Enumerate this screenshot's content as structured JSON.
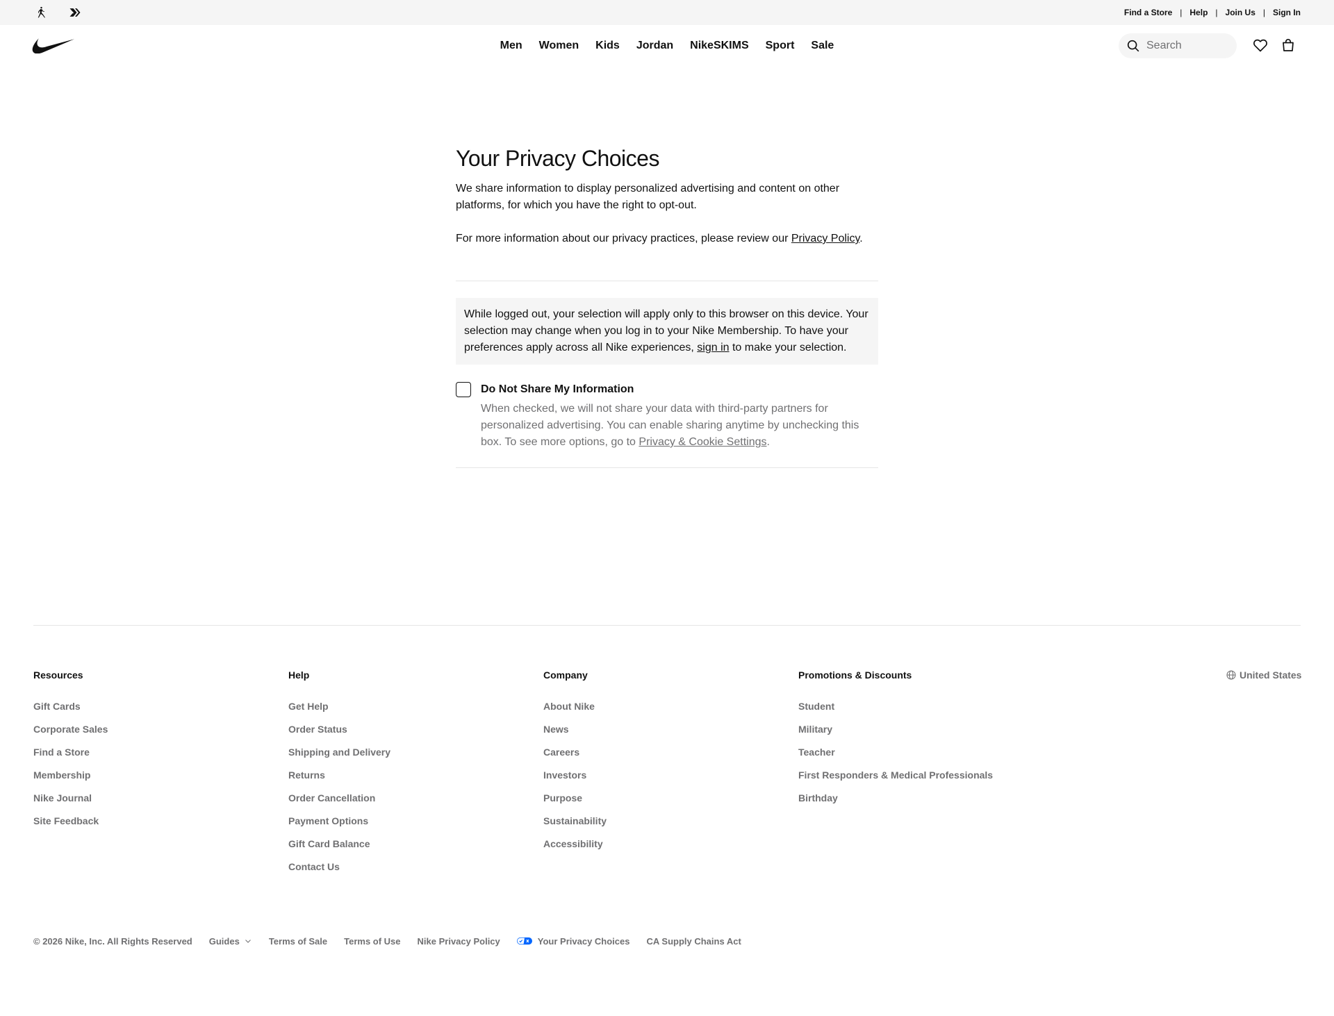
{
  "utility_bar": {
    "brand_icons": [
      "jordan-jumpman-icon",
      "converse-icon"
    ],
    "links": [
      "Find a Store",
      "Help",
      "Join Us",
      "Sign In"
    ],
    "separator": "|"
  },
  "header": {
    "logo": "nike-swoosh-icon",
    "nav": [
      "Men",
      "Women",
      "Kids",
      "Jordan",
      "NikeSKIMS",
      "Sport",
      "Sale"
    ],
    "search_placeholder": "Search",
    "icons": [
      "search-icon",
      "heart-icon",
      "bag-icon"
    ]
  },
  "main": {
    "title": "Your Privacy Choices",
    "para1": "We share information to display personalized advertising and content on other platforms, for which you have the right to opt-out.",
    "para2_prefix": "For more information about our privacy practices, please review our ",
    "para2_link": "Privacy Policy",
    "para2_suffix": ".",
    "info_prefix": "While logged out, your selection will apply only to this browser on this device. Your selection may change when you log in to your Nike Membership. To have your preferences apply across all Nike experiences, ",
    "info_link": "sign in",
    "info_suffix": " to make your selection.",
    "optout_label": "Do Not Share My Information",
    "optout_checked": false,
    "optout_desc_prefix": "When checked, we will not share your data with third-party partners for personalized advertising. You can enable sharing anytime by unchecking this box. To see more options, go to ",
    "optout_desc_link": "Privacy & Cookie Settings",
    "optout_desc_suffix": "."
  },
  "footer": {
    "columns": [
      {
        "heading": "Resources",
        "links": [
          "Gift Cards",
          "Corporate Sales",
          "Find a Store",
          "Membership",
          "Nike Journal",
          "Site Feedback"
        ]
      },
      {
        "heading": "Help",
        "links": [
          "Get Help",
          "Order Status",
          "Shipping and Delivery",
          "Returns",
          "Order Cancellation",
          "Payment Options",
          "Gift Card Balance",
          "Contact Us"
        ]
      },
      {
        "heading": "Company",
        "links": [
          "About Nike",
          "News",
          "Careers",
          "Investors",
          "Purpose",
          "Sustainability",
          "Accessibility"
        ]
      },
      {
        "heading": "Promotions & Discounts",
        "links": [
          "Student",
          "Military",
          "Teacher",
          "First Responders & Medical Professionals",
          "Birthday"
        ]
      }
    ],
    "locale": "United States",
    "legal": {
      "copyright": "© 2026 Nike, Inc. All Rights Reserved",
      "guides": "Guides",
      "terms_of_sale": "Terms of Sale",
      "terms_of_use": "Terms of Use",
      "privacy_policy": "Nike Privacy Policy",
      "privacy_choices": "Your Privacy Choices",
      "ca_supply": "CA Supply Chains Act"
    }
  },
  "colors": {
    "text": "#111111",
    "secondary_text": "#707072",
    "panel_bg": "#f5f5f5",
    "divider": "#e5e5e5",
    "privacy_icon_blue": "#0066ff"
  }
}
